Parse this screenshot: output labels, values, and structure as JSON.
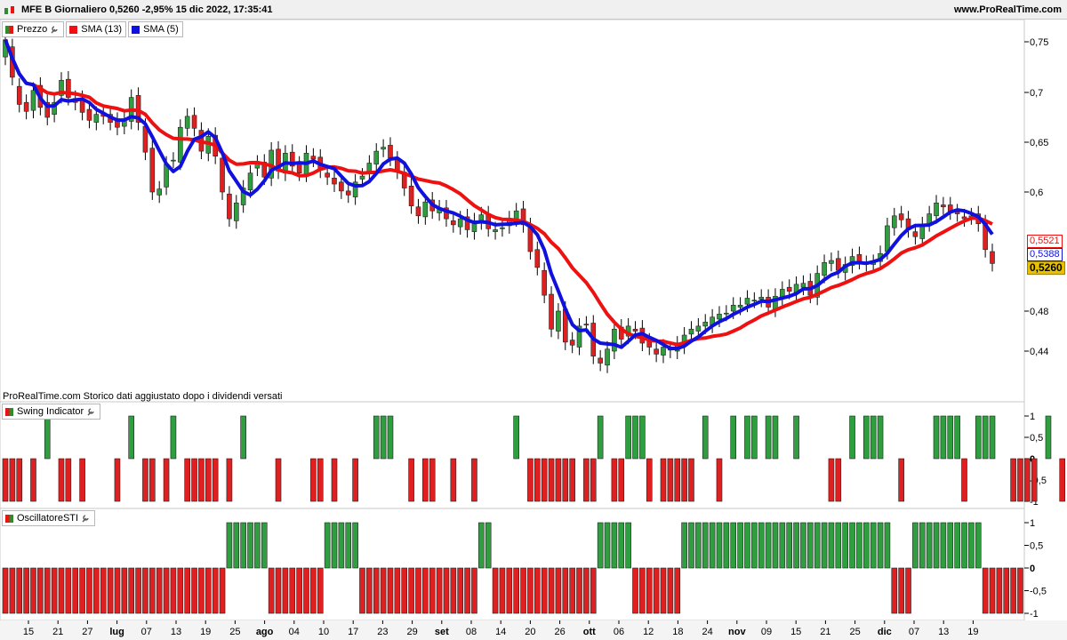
{
  "header": {
    "title": "MFE B Giornaliero 0,5260 -2,95% 15 dic 2022, 17:35:41",
    "site": "www.ProRealTime.com"
  },
  "legend": [
    {
      "label": "Prezzo",
      "color": "#2e8b2e"
    },
    {
      "label": "SMA (13)",
      "color": "#ee1111"
    },
    {
      "label": "SMA (5)",
      "color": "#1111dd"
    }
  ],
  "note": "ProRealTime.com  Storico dati aggiustato dopo i dividendi versati",
  "panels": {
    "swing": {
      "label": "Swing Indicator"
    },
    "sti": {
      "label": "OscillatoreSTI"
    }
  },
  "price_axis": {
    "ticks": [
      "0,75",
      "0,7",
      "0,65",
      "0,6",
      "0,48",
      "0,44"
    ],
    "tick_values": [
      0.75,
      0.7,
      0.65,
      0.6,
      0.48,
      0.44
    ]
  },
  "osc_axis": {
    "ticks": [
      "1",
      "0,5",
      "0",
      "-0,5",
      "-1"
    ],
    "tick_values": [
      1,
      0.5,
      0,
      -0.5,
      -1
    ]
  },
  "x_axis": {
    "labels": [
      "15",
      "21",
      "27",
      "lug",
      "07",
      "13",
      "19",
      "25",
      "ago",
      "04",
      "10",
      "17",
      "23",
      "29",
      "set",
      "08",
      "14",
      "20",
      "26",
      "ott",
      "06",
      "12",
      "18",
      "24",
      "nov",
      "09",
      "15",
      "21",
      "25",
      "dic",
      "07",
      "13",
      "19"
    ],
    "bold": [
      "lug",
      "ago",
      "set",
      "ott",
      "nov",
      "dic"
    ]
  },
  "price_boxes": [
    {
      "label": "0,5521",
      "value": 0.5521,
      "color": "#ee1111"
    },
    {
      "label": "0,5388",
      "value": 0.5388,
      "color": "#1111dd"
    },
    {
      "label": "0,5260",
      "value": 0.526,
      "color": "#e8c200"
    }
  ],
  "chart_data": [
    {
      "type": "candlestick",
      "title": "MFE B Giornaliero",
      "series": [
        {
          "name": "Prezzo",
          "close": [
            0.752,
            0.715,
            0.688,
            0.681,
            0.702,
            0.685,
            0.675,
            0.69,
            0.712,
            0.695,
            0.69,
            0.68,
            0.672,
            0.678,
            0.676,
            0.67,
            0.665,
            0.672,
            0.695,
            0.67,
            0.64,
            0.6,
            0.603,
            0.628,
            0.632,
            0.665,
            0.676,
            0.664,
            0.641,
            0.656,
            0.636,
            0.6,
            0.573,
            0.589,
            0.604,
            0.619,
            0.629,
            0.615,
            0.642,
            0.621,
            0.639,
            0.626,
            0.619,
            0.639,
            0.633,
            0.622,
            0.615,
            0.608,
            0.601,
            0.597,
            0.61,
            0.616,
            0.629,
            0.641,
            0.645,
            0.634,
            0.621,
            0.604,
            0.586,
            0.576,
            0.59,
            0.581,
            0.584,
            0.573,
            0.567,
            0.573,
            0.562,
            0.571,
            0.577,
            0.563,
            0.562,
            0.564,
            0.573,
            0.581,
            0.567,
            0.54,
            0.524,
            0.496,
            0.462,
            0.48,
            0.449,
            0.446,
            0.465,
            0.466,
            0.435,
            0.428,
            0.442,
            0.462,
            0.452,
            0.465,
            0.46,
            0.448,
            0.444,
            0.437,
            0.444,
            0.441,
            0.447,
            0.456,
            0.462,
            0.465,
            0.469,
            0.474,
            0.477,
            0.478,
            0.486,
            0.486,
            0.493,
            0.491,
            0.494,
            0.484,
            0.495,
            0.502,
            0.5,
            0.507,
            0.508,
            0.496,
            0.518,
            0.529,
            0.531,
            0.521,
            0.527,
            0.535,
            0.53,
            0.528,
            0.529,
            0.538,
            0.566,
            0.576,
            0.572,
            0.562,
            0.555,
            0.567,
            0.578,
            0.589,
            0.585,
            0.58,
            0.578,
            0.573,
            0.576,
            0.568,
            0.542,
            0.528
          ],
          "open": [
            0.735,
            0.745,
            0.706,
            0.69,
            0.682,
            0.707,
            0.69,
            0.678,
            0.697,
            0.713,
            0.694,
            0.694,
            0.683,
            0.67,
            0.679,
            0.678,
            0.672,
            0.666,
            0.671,
            0.697,
            0.666,
            0.644,
            0.597,
            0.605,
            0.632,
            0.63,
            0.664,
            0.677,
            0.662,
            0.639,
            0.657,
            0.634,
            0.598,
            0.571,
            0.587,
            0.602,
            0.624,
            0.63,
            0.614,
            0.643,
            0.619,
            0.64,
            0.628,
            0.618,
            0.636,
            0.635,
            0.619,
            0.614,
            0.61,
            0.601,
            0.595,
            0.613,
            0.619,
            0.628,
            0.643,
            0.647,
            0.633,
            0.62,
            0.606,
            0.585,
            0.575,
            0.592,
            0.579,
            0.584,
            0.571,
            0.565,
            0.575,
            0.56,
            0.57,
            0.578,
            0.56,
            0.563,
            0.566,
            0.573,
            0.583,
            0.566,
            0.542,
            0.521,
            0.497,
            0.46,
            0.482,
            0.451,
            0.444,
            0.467,
            0.468,
            0.433,
            0.426,
            0.44,
            0.464,
            0.455,
            0.462,
            0.463,
            0.45,
            0.442,
            0.436,
            0.442,
            0.44,
            0.445,
            0.457,
            0.46,
            0.465,
            0.466,
            0.472,
            0.478,
            0.48,
            0.484,
            0.487,
            0.491,
            0.492,
            0.494,
            0.482,
            0.494,
            0.504,
            0.499,
            0.504,
            0.51,
            0.494,
            0.516,
            0.528,
            0.533,
            0.519,
            0.526,
            0.537,
            0.528,
            0.527,
            0.53,
            0.54,
            0.564,
            0.578,
            0.573,
            0.56,
            0.553,
            0.568,
            0.576,
            0.587,
            0.587,
            0.58,
            0.575,
            0.575,
            0.578,
            0.569,
            0.54
          ]
        }
      ],
      "overlays": [
        {
          "name": "SMA (13)",
          "last": 0.5521
        },
        {
          "name": "SMA (5)",
          "last": 0.5388
        }
      ],
      "ylim": [
        0.41,
        0.77
      ]
    },
    {
      "type": "bar",
      "title": "Swing Indicator",
      "ylim": [
        -1,
        1
      ],
      "values": [
        -1,
        -1,
        -1,
        0,
        -1,
        0,
        1,
        0,
        -1,
        -1,
        0,
        -1,
        0,
        0,
        0,
        0,
        -1,
        0,
        1,
        0,
        -1,
        -1,
        0,
        -1,
        1,
        0,
        -1,
        -1,
        -1,
        -1,
        -1,
        0,
        -1,
        0,
        1,
        0,
        0,
        0,
        0,
        -1,
        0,
        0,
        0,
        0,
        -1,
        -1,
        0,
        -1,
        0,
        0,
        -1,
        0,
        0,
        1,
        1,
        1,
        0,
        0,
        -1,
        0,
        -1,
        -1,
        0,
        0,
        -1,
        0,
        0,
        -1,
        0,
        0,
        0,
        0,
        0,
        1,
        0,
        -1,
        -1,
        -1,
        -1,
        -1,
        -1,
        -1,
        0,
        -1,
        -1,
        1,
        0,
        -1,
        -1,
        1,
        1,
        1,
        -1,
        0,
        -1,
        -1,
        -1,
        -1,
        -1,
        0,
        1,
        0,
        -1,
        0,
        1,
        0,
        1,
        1,
        0,
        1,
        1,
        0,
        0,
        1,
        0,
        0,
        0,
        0,
        -1,
        -1,
        0,
        1,
        0,
        1,
        1,
        1,
        0,
        0,
        -1,
        0,
        0,
        0,
        0,
        1,
        1,
        1,
        1,
        -1,
        0,
        1,
        1,
        1,
        0,
        0,
        -1,
        -1,
        -1,
        -1,
        0,
        1,
        0,
        -1
      ]
    },
    {
      "type": "bar",
      "title": "OscillatoreSTI",
      "ylim": [
        -1,
        1
      ],
      "values": [
        -1,
        -1,
        -1,
        -1,
        -1,
        -1,
        -1,
        -1,
        -1,
        -1,
        -1,
        -1,
        -1,
        -1,
        -1,
        -1,
        -1,
        -1,
        -1,
        -1,
        -1,
        -1,
        -1,
        -1,
        -1,
        -1,
        -1,
        -1,
        -1,
        -1,
        -1,
        -1,
        1,
        1,
        1,
        1,
        1,
        1,
        -1,
        -1,
        -1,
        -1,
        -1,
        -1,
        -1,
        -1,
        1,
        1,
        1,
        1,
        1,
        -1,
        -1,
        -1,
        -1,
        -1,
        -1,
        -1,
        -1,
        -1,
        -1,
        -1,
        -1,
        -1,
        -1,
        -1,
        -1,
        -1,
        1,
        1,
        -1,
        -1,
        -1,
        -1,
        -1,
        -1,
        -1,
        -1,
        -1,
        -1,
        -1,
        -1,
        -1,
        -1,
        -1,
        1,
        1,
        1,
        1,
        1,
        -1,
        -1,
        -1,
        -1,
        -1,
        -1,
        -1,
        1,
        1,
        1,
        1,
        1,
        1,
        1,
        1,
        1,
        1,
        1,
        1,
        1,
        1,
        1,
        1,
        1,
        1,
        1,
        1,
        1,
        1,
        1,
        1,
        1,
        1,
        1,
        1,
        1,
        1,
        -1,
        -1,
        -1,
        1,
        1,
        1,
        1,
        1,
        1,
        1,
        1,
        1,
        1,
        -1,
        -1,
        -1,
        -1,
        -1,
        -1
      ]
    }
  ]
}
